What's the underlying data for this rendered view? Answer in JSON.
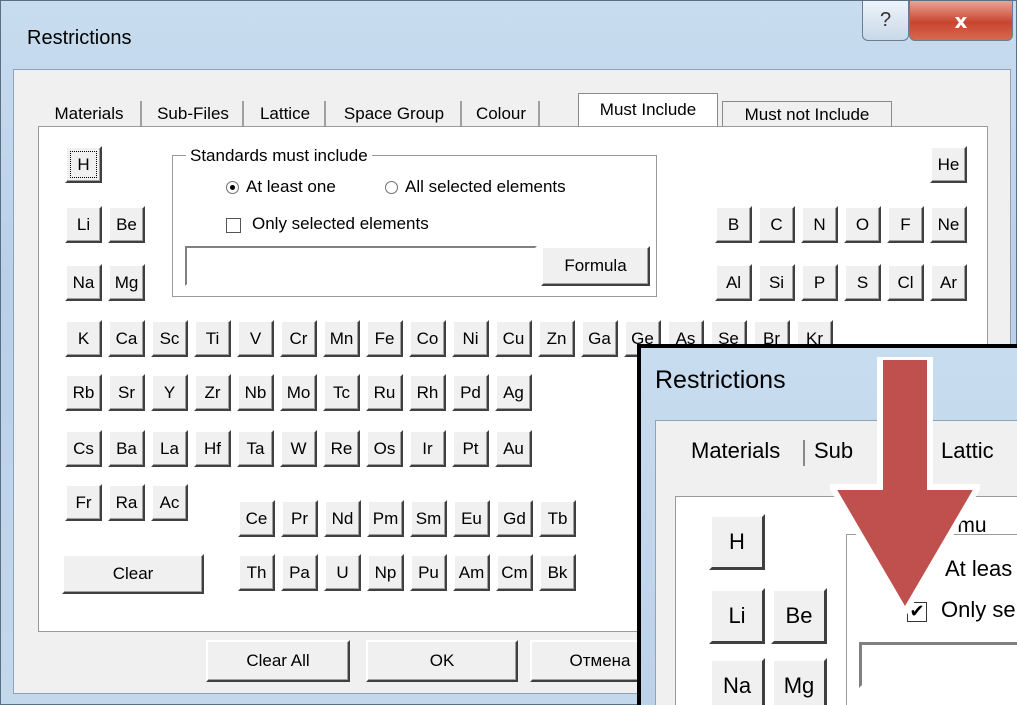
{
  "window": {
    "title": "Restrictions",
    "help_glyph": "?",
    "close_glyph": "x"
  },
  "tabs": [
    "Materials",
    "Sub-Files",
    "Lattice",
    "Space Group",
    "Colour",
    "Must Include",
    "Must not Include"
  ],
  "active_tab": "Must Include",
  "group": {
    "legend": "Standards must include",
    "radio_at_least_one": "At least one",
    "radio_all_selected": "All selected elements",
    "only_selected": "Only selected elements",
    "formula_value": "",
    "formula_button": "Formula"
  },
  "elements": {
    "row1": [
      "H",
      "He"
    ],
    "row2": [
      "Li",
      "Be",
      "B",
      "C",
      "N",
      "O",
      "F",
      "Ne"
    ],
    "row3": [
      "Na",
      "Mg",
      "Al",
      "Si",
      "P",
      "S",
      "Cl",
      "Ar"
    ],
    "row4": [
      "K",
      "Ca",
      "Sc",
      "Ti",
      "V",
      "Cr",
      "Mn",
      "Fe",
      "Co",
      "Ni",
      "Cu",
      "Zn",
      "Ga",
      "Ge",
      "As",
      "Se",
      "Br",
      "Kr"
    ],
    "row5": [
      "Rb",
      "Sr",
      "Y",
      "Zr",
      "Nb",
      "Mo",
      "Tc",
      "Ru",
      "Rh",
      "Pd",
      "Ag"
    ],
    "row6": [
      "Cs",
      "Ba",
      "La",
      "Hf",
      "Ta",
      "W",
      "Re",
      "Os",
      "Ir",
      "Pt",
      "Au"
    ],
    "row7": [
      "Fr",
      "Ra",
      "Ac"
    ],
    "lanthanides": [
      "Ce",
      "Pr",
      "Nd",
      "Pm",
      "Sm",
      "Eu",
      "Gd",
      "Tb"
    ],
    "actinides": [
      "Th",
      "Pa",
      "U",
      "Np",
      "Pu",
      "Am",
      "Cm",
      "Bk"
    ]
  },
  "buttons": {
    "clear": "Clear",
    "clear_all": "Clear All",
    "ok": "OK",
    "cancel": "Отмена"
  },
  "zoom": {
    "title": "Restrictions",
    "tab1": "Materials",
    "tab2": "Sub",
    "tab3": "Lattic",
    "legend_fragment": "s mu",
    "radio_fragment": "At leas",
    "checkbox_fragment": "Only se",
    "checkbox_checked": true,
    "elements": [
      "H",
      "Li",
      "Be",
      "Na",
      "Mg"
    ]
  },
  "colors": {
    "arrow": "#c0504d",
    "close": "#c8452f"
  }
}
